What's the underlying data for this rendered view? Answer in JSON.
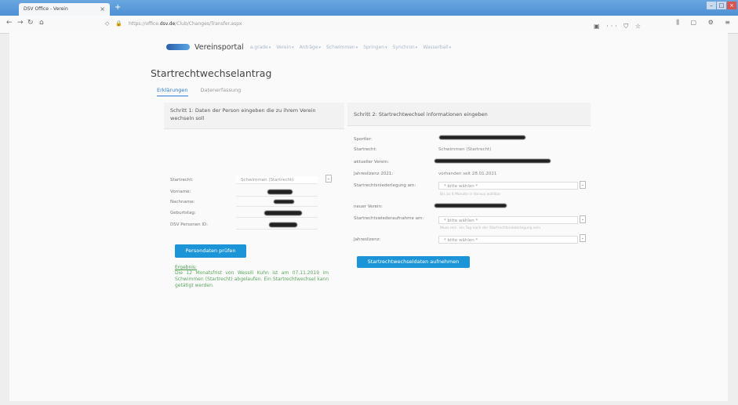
{
  "browser": {
    "tab_title": "DSV Office - Verein",
    "tab_close": "×",
    "new_tab": "+",
    "url_prefix": "https://office.",
    "url_domain": "dsv.de",
    "url_path": "/Club/Changes/Transfer.aspx",
    "win_min": "–",
    "win_max": "□",
    "win_close": "×"
  },
  "menu": {
    "brand": "Vereinsportal",
    "items": [
      "a.grade",
      "Verein",
      "Anträge",
      "Schwimmen",
      "Springen",
      "Synchron",
      "Wasserball"
    ]
  },
  "page": {
    "title": "Startrechtwechselantrag",
    "tabs": [
      "Erklärungen",
      "Datenerfassung"
    ]
  },
  "step1": {
    "header": "Schritt 1: Daten der Person eingeben die zu ihrem Verein wechseln soll",
    "labels": {
      "startrecht": "Startrecht:",
      "vorname": "Vorname:",
      "nachname": "Nachname:",
      "geburtstag": "Geburtstag:",
      "personen_id": "DSV Personen ID:"
    },
    "startrecht_value": "Schwimmen (Startrecht)",
    "button": "Persondaten prüfen",
    "result_title": "Ergebnis:",
    "result_text": "Die 12 Monatsfrist von Wessili Kuhn ist am 07.11.2019 im Schwimmen (Startrecht) abgelaufen. Ein Startrechtwechsel kann getätigt werden."
  },
  "step2": {
    "header": "Schritt 2: Startrechtwechsel informationen eingeben",
    "labels": {
      "sportler": "Sportler:",
      "startrecht": "Startrecht:",
      "aktueller_verein": "aktueller Verein:",
      "jahreslizenz_2021": "Jahreslizenz 2021:",
      "niederlegung": "Startrechtsniederlegung am:",
      "neuer_verein": "neuer Verein:",
      "wiederaufnahme": "Startrechtswiederaufnahme am:",
      "jahreslizenz": "Jahreslizenz:"
    },
    "startrecht_value": "Schwimmen (Startrecht)",
    "jahreslizenz_value": "vorhanden seit 28.01.2021",
    "select_placeholder": "* bitte wählen *",
    "hint_niederlegung": "Bis zu 6 Monate in Voraus wählbar",
    "hint_wiederaufnahme": "Muss min. ein Tag nach der Startrechtsniederlegung sein",
    "button": "Startrechtwechseldaten aufnehmen"
  }
}
